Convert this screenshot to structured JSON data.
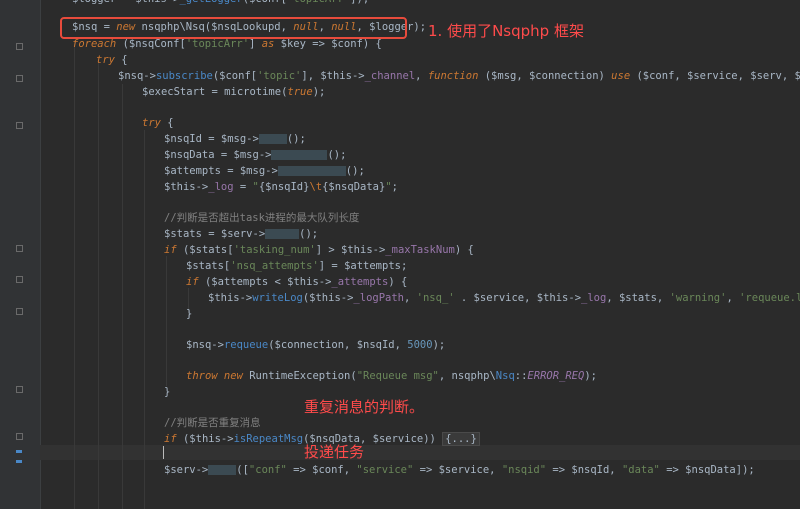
{
  "annotations": {
    "framework": "1. 使用了Nsqphp 框架",
    "repeat": "重复消息的判断。",
    "deliver": "投递任务"
  },
  "code": {
    "l0": "$logger = $this->_getLogger($conf['topicArr']);",
    "l1": "$nsq = new nsqphp\\Nsq($nsqLookupd, null, null, $logger);",
    "l2": "foreach ($nsqConf['topicArr'] as $key => $conf) {",
    "l3": "try {",
    "l4": "$nsq->subscribe($conf['topic'], $this->_channel, function ($msg, $connection) use ($conf, $service, $serv, $nsq) {",
    "l5": "$execStart = microtime(true);",
    "l6": "try {",
    "l7": "$nsqId = $msg->getId();",
    "l8": "$nsqData = $msg->getPayload();",
    "l9": "$attempts = $msg->getAttempts();",
    "l10": "$this->_log = \"{$nsqId}\\t{$nsqData}\";",
    "l11": "//判断是否超出task进程的最大队列长度",
    "l12": "$stats = $serv->stats();",
    "l13": "if ($stats['tasking_num'] > $this->_maxTaskNum) {",
    "l14": "$stats['nsq_attempts'] = $attempts;",
    "l15": "if ($attempts < $this->_attempts) {",
    "l16": "$this->writeLog($this->_logPath, 'nsq_' . $service, $this->_log, $stats, 'warning', 'requeue.log');",
    "l17": "}",
    "l18": "$nsq->requeue($connection, $nsqId, 5000);",
    "l19": "throw new RuntimeException(\"Requeue msg\", nsqphp\\Nsq::ERROR_REQ);",
    "l20": "}",
    "l21": "//判断是否重复消息",
    "l22": "if ($this->isRepeatMsg($nsqData, $service)) {...}",
    "l23": "$serv->task([\"conf\" => $conf, \"service\" => $service, \"nsqid\" => $nsqId, \"data\" => $nsqData]);"
  },
  "colors": {
    "background": "#2b2b2b",
    "keyword": "#cc7832",
    "string": "#6a8759",
    "number": "#6897bb",
    "comment": "#808080",
    "property": "#9876aa",
    "annotation": "#ff4b4b"
  }
}
